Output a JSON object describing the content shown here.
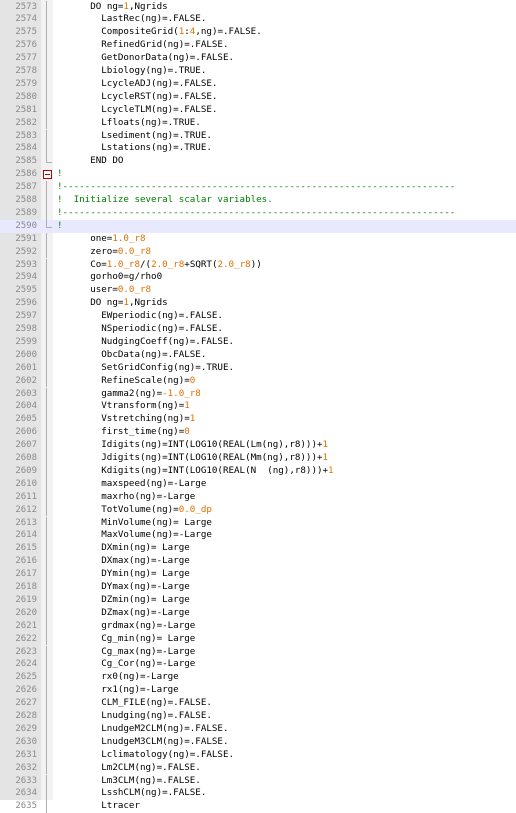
{
  "editor": {
    "lines": [
      {
        "num": "2573",
        "fold": "v",
        "seg": [
          [
            "      ",
            ""
          ],
          [
            "DO",
            ""
          ],
          [
            " ng=",
            ""
          ],
          [
            "1",
            "t-n"
          ],
          [
            ",Ngrids",
            ""
          ]
        ]
      },
      {
        "num": "2574",
        "fold": "v",
        "seg": [
          [
            "        LastRec(ng)=.FALSE.",
            ""
          ]
        ]
      },
      {
        "num": "2575",
        "fold": "v",
        "seg": [
          [
            "        CompositeGrid(",
            ""
          ],
          [
            "1",
            "t-n"
          ],
          [
            ":",
            ""
          ],
          [
            "4",
            "t-n"
          ],
          [
            ",ng)=.FALSE.",
            ""
          ]
        ]
      },
      {
        "num": "2576",
        "fold": "v",
        "seg": [
          [
            "        RefinedGrid(ng)=.FALSE.",
            ""
          ]
        ]
      },
      {
        "num": "2577",
        "fold": "v",
        "seg": [
          [
            "        GetDonorData(ng)=.FALSE.",
            ""
          ]
        ]
      },
      {
        "num": "2578",
        "fold": "v",
        "seg": [
          [
            "        Lbiology(ng)=.TRUE.",
            ""
          ]
        ]
      },
      {
        "num": "2579",
        "fold": "v",
        "seg": [
          [
            "        LcycleADJ(ng)=.FALSE.",
            ""
          ]
        ]
      },
      {
        "num": "2580",
        "fold": "v",
        "seg": [
          [
            "        LcycleRST(ng)=.FALSE.",
            ""
          ]
        ]
      },
      {
        "num": "2581",
        "fold": "v",
        "seg": [
          [
            "        LcycleTLM(ng)=.FALSE.",
            ""
          ]
        ]
      },
      {
        "num": "2582",
        "fold": "v",
        "seg": [
          [
            "        Lfloats(ng)=.TRUE.",
            ""
          ]
        ]
      },
      {
        "num": "2583",
        "fold": "v",
        "seg": [
          [
            "        Lsediment(ng)=.TRUE.",
            ""
          ]
        ]
      },
      {
        "num": "2584",
        "fold": "v",
        "seg": [
          [
            "        Lstations(ng)=.TRUE.",
            ""
          ]
        ]
      },
      {
        "num": "2585",
        "fold": "end",
        "seg": [
          [
            "      END DO",
            ""
          ]
        ]
      },
      {
        "num": "2586",
        "fold": "box",
        "seg": [
          [
            "!",
            "t-c"
          ]
        ]
      },
      {
        "num": "2587",
        "fold": "v",
        "seg": [
          [
            "!-----------------------------------------------------------------------",
            "t-c"
          ]
        ]
      },
      {
        "num": "2588",
        "fold": "v",
        "seg": [
          [
            "!  Initialize several scalar variables.",
            "t-c"
          ]
        ]
      },
      {
        "num": "2589",
        "fold": "v",
        "seg": [
          [
            "!-----------------------------------------------------------------------",
            "t-c"
          ]
        ]
      },
      {
        "num": "2590",
        "fold": "end",
        "hl": true,
        "seg": [
          [
            "!",
            "t-c"
          ]
        ]
      },
      {
        "num": "2591",
        "fold": "v",
        "seg": [
          [
            "      one=",
            ""
          ],
          [
            "1.0_r8",
            "t-n"
          ]
        ]
      },
      {
        "num": "2592",
        "fold": "v",
        "seg": [
          [
            "      zero=",
            ""
          ],
          [
            "0.0_r8",
            "t-n"
          ]
        ]
      },
      {
        "num": "2593",
        "fold": "v",
        "seg": [
          [
            "      Co=",
            ""
          ],
          [
            "1.0_r8",
            "t-n"
          ],
          [
            "/(",
            ""
          ],
          [
            "2.0_r8",
            "t-n"
          ],
          [
            "+SQRT(",
            ""
          ],
          [
            "2.0_r8",
            "t-n"
          ],
          [
            "))",
            ""
          ]
        ]
      },
      {
        "num": "2594",
        "fold": "v",
        "seg": [
          [
            "      gorho0=g/rho0",
            ""
          ]
        ]
      },
      {
        "num": "2595",
        "fold": "v",
        "seg": [
          [
            "      user=",
            ""
          ],
          [
            "0.0_r8",
            "t-n"
          ]
        ]
      },
      {
        "num": "2596",
        "fold": "v",
        "seg": [
          [
            "      DO ng=",
            ""
          ],
          [
            "1",
            "t-n"
          ],
          [
            ",Ngrids",
            ""
          ]
        ]
      },
      {
        "num": "2597",
        "fold": "v",
        "seg": [
          [
            "        EWperiodic(ng)=.FALSE.",
            ""
          ]
        ]
      },
      {
        "num": "2598",
        "fold": "v",
        "seg": [
          [
            "        NSperiodic(ng)=.FALSE.",
            ""
          ]
        ]
      },
      {
        "num": "2599",
        "fold": "v",
        "seg": [
          [
            "        NudgingCoeff(ng)=.FALSE.",
            ""
          ]
        ]
      },
      {
        "num": "2600",
        "fold": "v",
        "seg": [
          [
            "        ObcData(ng)=.FALSE.",
            ""
          ]
        ]
      },
      {
        "num": "2601",
        "fold": "v",
        "seg": [
          [
            "        SetGridConfig(ng)=.TRUE.",
            ""
          ]
        ]
      },
      {
        "num": "2602",
        "fold": "v",
        "seg": [
          [
            "        RefineScale(ng)=",
            ""
          ],
          [
            "0",
            "t-n"
          ]
        ]
      },
      {
        "num": "2603",
        "fold": "v",
        "seg": [
          [
            "        gamma2(ng)=",
            ""
          ],
          [
            "-1.0_r8",
            "t-n"
          ]
        ]
      },
      {
        "num": "2604",
        "fold": "v",
        "seg": [
          [
            "        Vtransform(ng)=",
            ""
          ],
          [
            "1",
            "t-n"
          ]
        ]
      },
      {
        "num": "2605",
        "fold": "v",
        "seg": [
          [
            "        Vstretching(ng)=",
            ""
          ],
          [
            "1",
            "t-n"
          ]
        ]
      },
      {
        "num": "2606",
        "fold": "v",
        "seg": [
          [
            "        first_time(ng)=",
            ""
          ],
          [
            "0",
            "t-n"
          ]
        ]
      },
      {
        "num": "2607",
        "fold": "v",
        "seg": [
          [
            "        Idigits(ng)=INT(LOG10(REAL(Lm(ng),r8)))+",
            ""
          ],
          [
            "1",
            "t-n"
          ]
        ]
      },
      {
        "num": "2608",
        "fold": "v",
        "seg": [
          [
            "        Jdigits(ng)=INT(LOG10(REAL(Mm(ng),r8)))+",
            ""
          ],
          [
            "1",
            "t-n"
          ]
        ]
      },
      {
        "num": "2609",
        "fold": "v",
        "seg": [
          [
            "        Kdigits(ng)=INT(LOG10(REAL(N  (ng),r8)))+",
            ""
          ],
          [
            "1",
            "t-n"
          ]
        ]
      },
      {
        "num": "2610",
        "fold": "v",
        "seg": [
          [
            "        maxspeed(ng)=-Large",
            ""
          ]
        ]
      },
      {
        "num": "2611",
        "fold": "v",
        "seg": [
          [
            "        maxrho(ng)=-Large",
            ""
          ]
        ]
      },
      {
        "num": "2612",
        "fold": "v",
        "seg": [
          [
            "        TotVolume(ng)=",
            ""
          ],
          [
            "0.0_dp",
            "t-n"
          ]
        ]
      },
      {
        "num": "2613",
        "fold": "v",
        "seg": [
          [
            "        MinVolume(ng)= Large",
            ""
          ]
        ]
      },
      {
        "num": "2614",
        "fold": "v",
        "seg": [
          [
            "        MaxVolume(ng)=-Large",
            ""
          ]
        ]
      },
      {
        "num": "2615",
        "fold": "v",
        "seg": [
          [
            "        DXmin(ng)= Large",
            ""
          ]
        ]
      },
      {
        "num": "2616",
        "fold": "v",
        "seg": [
          [
            "        DXmax(ng)=-Large",
            ""
          ]
        ]
      },
      {
        "num": "2617",
        "fold": "v",
        "seg": [
          [
            "        DYmin(ng)= Large",
            ""
          ]
        ]
      },
      {
        "num": "2618",
        "fold": "v",
        "seg": [
          [
            "        DYmax(ng)=-Large",
            ""
          ]
        ]
      },
      {
        "num": "2619",
        "fold": "v",
        "seg": [
          [
            "        DZmin(ng)= Large",
            ""
          ]
        ]
      },
      {
        "num": "2620",
        "fold": "v",
        "seg": [
          [
            "        DZmax(ng)=-Large",
            ""
          ]
        ]
      },
      {
        "num": "2621",
        "fold": "v",
        "seg": [
          [
            "        grdmax(ng)=-Large",
            ""
          ]
        ]
      },
      {
        "num": "2622",
        "fold": "v",
        "seg": [
          [
            "        Cg_min(ng)= Large",
            ""
          ]
        ]
      },
      {
        "num": "2623",
        "fold": "v",
        "seg": [
          [
            "        Cg_max(ng)=-Large",
            ""
          ]
        ]
      },
      {
        "num": "2624",
        "fold": "v",
        "seg": [
          [
            "        Cg_Cor(ng)=-Large",
            ""
          ]
        ]
      },
      {
        "num": "2625",
        "fold": "v",
        "seg": [
          [
            "        rx0(ng)=-Large",
            ""
          ]
        ]
      },
      {
        "num": "2626",
        "fold": "v",
        "seg": [
          [
            "        rx1(ng)=-Large",
            ""
          ]
        ]
      },
      {
        "num": "2627",
        "fold": "v",
        "seg": [
          [
            "        CLM_FILE(ng)=.FALSE.",
            ""
          ]
        ]
      },
      {
        "num": "2628",
        "fold": "v",
        "seg": [
          [
            "        Lnudging(ng)=.FALSE.",
            ""
          ]
        ]
      },
      {
        "num": "2629",
        "fold": "v",
        "seg": [
          [
            "        LnudgeM2CLM(ng)=.FALSE.",
            ""
          ]
        ]
      },
      {
        "num": "2630",
        "fold": "v",
        "seg": [
          [
            "        LnudgeM3CLM(ng)=.FALSE.",
            ""
          ]
        ]
      },
      {
        "num": "2631",
        "fold": "v",
        "seg": [
          [
            "        Lclimatology(ng)=.FALSE.",
            ""
          ]
        ]
      },
      {
        "num": "2632",
        "fold": "v",
        "seg": [
          [
            "        Lm2CLM(ng)=.FALSE.",
            ""
          ]
        ]
      },
      {
        "num": "2633",
        "fold": "v",
        "seg": [
          [
            "        Lm3CLM(ng)=.FALSE.",
            ""
          ]
        ]
      },
      {
        "num": "2634",
        "fold": "v",
        "seg": [
          [
            "        LsshCLM(ng)=.FALSE.",
            ""
          ]
        ]
      },
      {
        "num": "2635",
        "fold": "v",
        "seg": [
          [
            "        Ltracer",
            ""
          ]
        ]
      }
    ]
  }
}
